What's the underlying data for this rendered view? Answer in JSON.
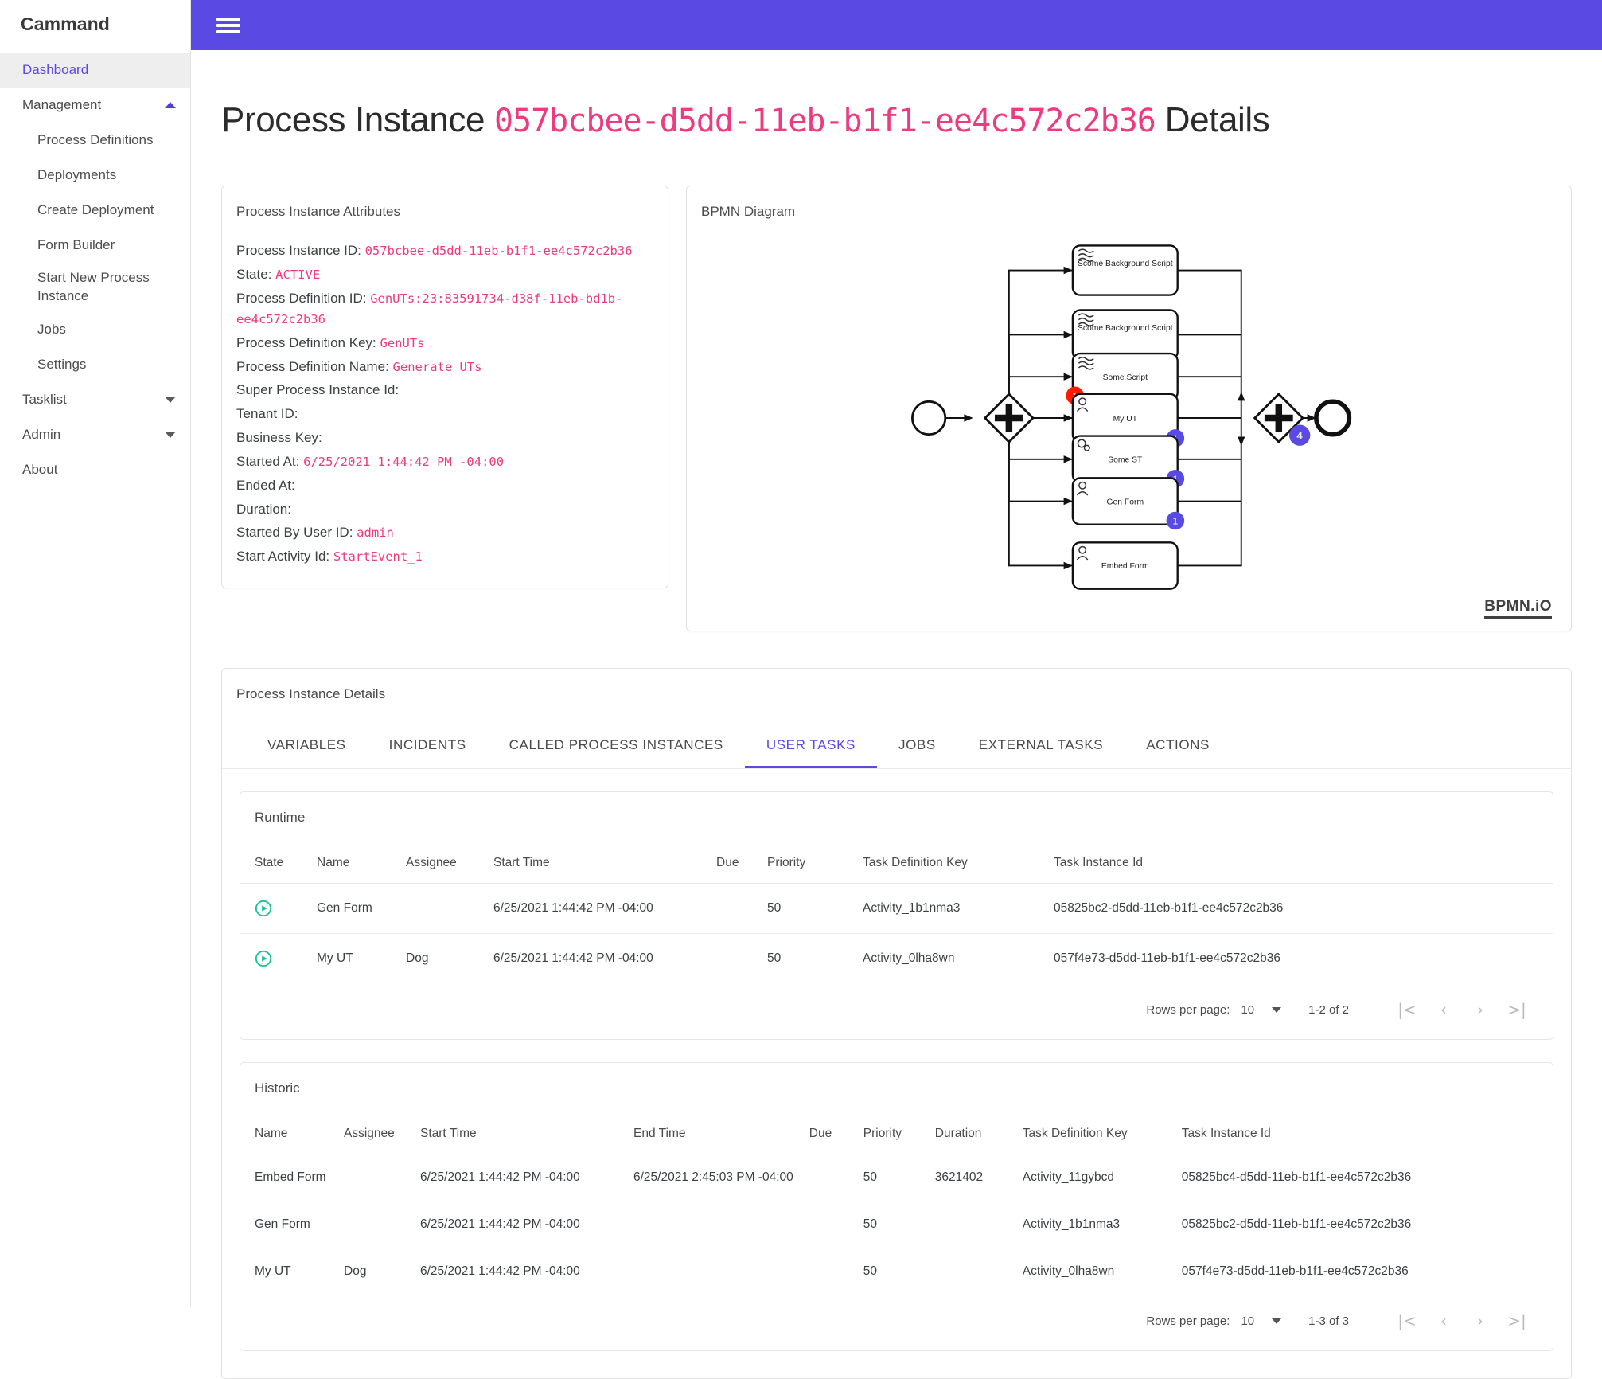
{
  "brand": "Cammand",
  "sidebar": {
    "items": [
      {
        "label": "Dashboard",
        "type": "item",
        "active": true
      },
      {
        "label": "Management",
        "type": "group",
        "caret": "up"
      },
      {
        "label": "Process Definitions",
        "type": "sub"
      },
      {
        "label": "Deployments",
        "type": "sub"
      },
      {
        "label": "Create Deployment",
        "type": "sub"
      },
      {
        "label": "Form Builder",
        "type": "sub"
      },
      {
        "label": "Start New Process Instance",
        "type": "sub"
      },
      {
        "label": "Jobs",
        "type": "sub"
      },
      {
        "label": "Settings",
        "type": "sub"
      },
      {
        "label": "Tasklist",
        "type": "group",
        "caret": "down"
      },
      {
        "label": "Admin",
        "type": "group",
        "caret": "down"
      },
      {
        "label": "About",
        "type": "item"
      }
    ]
  },
  "topbar": {
    "menu_icon": "hamburger-icon",
    "background": "#5a4ae3"
  },
  "page": {
    "title_prefix": "Process Instance",
    "title_id": "057bcbee-d5dd-11eb-b1f1-ee4c572c2b36",
    "title_suffix": "Details"
  },
  "attributes": {
    "card_title": "Process Instance Attributes",
    "rows": [
      {
        "label": "Process Instance ID:",
        "value": "057bcbee-d5dd-11eb-b1f1-ee4c572c2b36"
      },
      {
        "label": "State:",
        "value": "ACTIVE"
      },
      {
        "label": "Process Definition ID:",
        "value": "GenUTs:23:83591734-d38f-11eb-bd1b-ee4c572c2b36"
      },
      {
        "label": "Process Definition Key:",
        "value": "GenUTs"
      },
      {
        "label": "Process Definition Name:",
        "value": "Generate UTs"
      },
      {
        "label": "Super Process Instance Id:",
        "value": ""
      },
      {
        "label": "Tenant ID:",
        "value": ""
      },
      {
        "label": "Business Key:",
        "value": ""
      },
      {
        "label": "Started At:",
        "value": "6/25/2021 1:44:42 PM -04:00"
      },
      {
        "label": "Ended At:",
        "value": ""
      },
      {
        "label": "Duration:",
        "value": ""
      },
      {
        "label": "Started By User ID:",
        "value": "admin"
      },
      {
        "label": "Start Activity Id:",
        "value": "StartEvent_1"
      }
    ]
  },
  "bpmn": {
    "card_title": "BPMN Diagram",
    "watermark": "BPMN.iO",
    "incident_color": "#ff1a00",
    "token_color": "#5a4ae3",
    "tasks": [
      {
        "name": "Scome Background Script",
        "type": "script",
        "badge": "",
        "badge_kind": ""
      },
      {
        "name": "Scome Background Script",
        "type": "script",
        "badge": "",
        "badge_kind": ""
      },
      {
        "name": "Some Script",
        "type": "script",
        "badge": "1",
        "badge_kind": "incident"
      },
      {
        "name": "My UT",
        "type": "user",
        "badge": "1",
        "badge_kind": "token"
      },
      {
        "name": "Some ST",
        "type": "service",
        "badge": "1",
        "badge_kind": "token"
      },
      {
        "name": "Gen Form",
        "type": "user",
        "badge": "1",
        "badge_kind": "token"
      },
      {
        "name": "Embed Form",
        "type": "user",
        "badge": "",
        "badge_kind": ""
      }
    ],
    "join_gateway_badge": "4"
  },
  "details": {
    "card_title": "Process Instance Details",
    "tabs": [
      {
        "label": "VARIABLES",
        "active": false
      },
      {
        "label": "INCIDENTS",
        "active": false
      },
      {
        "label": "CALLED PROCESS INSTANCES",
        "active": false
      },
      {
        "label": "USER TASKS",
        "active": true
      },
      {
        "label": "JOBS",
        "active": false
      },
      {
        "label": "EXTERNAL TASKS",
        "active": false
      },
      {
        "label": "ACTIONS",
        "active": false
      }
    ],
    "runtime": {
      "title": "Runtime",
      "columns": [
        "State",
        "Name",
        "Assignee",
        "Start Time",
        "Due",
        "Priority",
        "Task Definition Key",
        "Task Instance Id"
      ],
      "rows": [
        {
          "state_icon": "play-circle-icon",
          "name": "Gen Form",
          "assignee": "",
          "start_time": "6/25/2021 1:44:42 PM -04:00",
          "due": "",
          "priority": "50",
          "task_definition_key": "Activity_1b1nma3",
          "task_instance_id": "05825bc2-d5dd-11eb-b1f1-ee4c572c2b36"
        },
        {
          "state_icon": "play-circle-icon",
          "name": "My UT",
          "assignee": "Dog",
          "start_time": "6/25/2021 1:44:42 PM -04:00",
          "due": "",
          "priority": "50",
          "task_definition_key": "Activity_0lha8wn",
          "task_instance_id": "057f4e73-d5dd-11eb-b1f1-ee4c572c2b36"
        }
      ],
      "pager": {
        "rows_per_page_label": "Rows per page:",
        "rows_per_page_value": "10",
        "range": "1-2 of 2",
        "first": "|<",
        "prev": "‹",
        "next": "›",
        "last": ">|"
      }
    },
    "historic": {
      "title": "Historic",
      "columns": [
        "Name",
        "Assignee",
        "Start Time",
        "End Time",
        "Due",
        "Priority",
        "Duration",
        "Task Definition Key",
        "Task Instance Id"
      ],
      "rows": [
        {
          "name": "Embed Form",
          "assignee": "",
          "start_time": "6/25/2021 1:44:42 PM -04:00",
          "end_time": "6/25/2021 2:45:03 PM -04:00",
          "due": "",
          "priority": "50",
          "duration": "3621402",
          "task_definition_key": "Activity_11gybcd",
          "task_instance_id": "05825bc4-d5dd-11eb-b1f1-ee4c572c2b36"
        },
        {
          "name": "Gen Form",
          "assignee": "",
          "start_time": "6/25/2021 1:44:42 PM -04:00",
          "end_time": "",
          "due": "",
          "priority": "50",
          "duration": "",
          "task_definition_key": "Activity_1b1nma3",
          "task_instance_id": "05825bc2-d5dd-11eb-b1f1-ee4c572c2b36"
        },
        {
          "name": "My UT",
          "assignee": "Dog",
          "start_time": "6/25/2021 1:44:42 PM -04:00",
          "end_time": "",
          "due": "",
          "priority": "50",
          "duration": "",
          "task_definition_key": "Activity_0lha8wn",
          "task_instance_id": "057f4e73-d5dd-11eb-b1f1-ee4c572c2b36"
        }
      ],
      "pager": {
        "rows_per_page_label": "Rows per page:",
        "rows_per_page_value": "10",
        "range": "1-3 of 3",
        "first": "|<",
        "prev": "‹",
        "next": "›",
        "last": ">|"
      }
    }
  }
}
